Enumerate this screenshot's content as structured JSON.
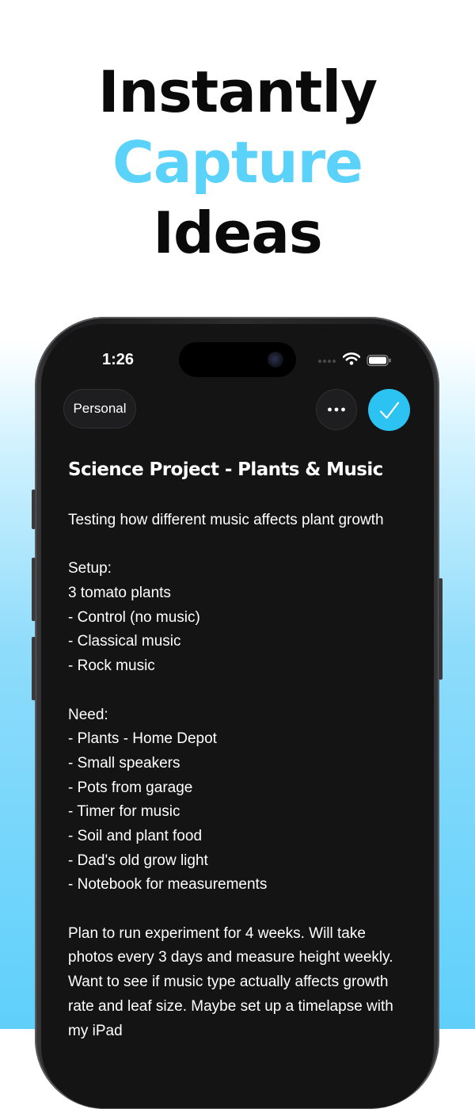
{
  "headline": {
    "line1": "Instantly",
    "line2": "Capture",
    "line3": "Ideas"
  },
  "colors": {
    "accent": "#5ad2fa",
    "done_button": "#2cc2f2",
    "screen_bg": "#141414",
    "text": "#ffffff"
  },
  "status_bar": {
    "time": "1:26",
    "icons": [
      "signal-dots-icon",
      "wifi-icon",
      "battery-icon"
    ]
  },
  "toolbar": {
    "folder_chip": "Personal",
    "more_icon": "ellipsis-icon",
    "done_icon": "checkmark-icon"
  },
  "note": {
    "title": "Science Project - Plants & Music",
    "lines": [
      "Testing how different music affects plant growth",
      "",
      "Setup:",
      "3 tomato plants",
      "- Control (no music)",
      "- Classical music",
      "- Rock music",
      "",
      "Need:",
      "- Plants - Home Depot",
      "- Small speakers",
      "- Pots from garage",
      "- Timer for music",
      "- Soil and plant food",
      "- Dad's old grow light",
      "- Notebook for measurements",
      ""
    ],
    "final_paragraph": "Plan to run experiment for 4 weeks. Will take photos every 3 days and measure height weekly. Want to see if music type actually affects growth rate and leaf size. Maybe set up a timelapse with my iPad"
  }
}
